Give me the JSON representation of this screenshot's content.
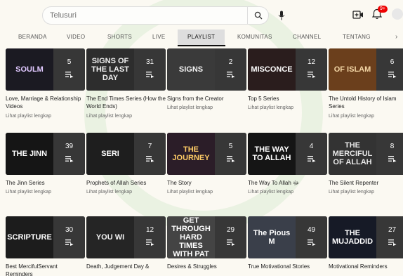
{
  "search": {
    "placeholder": "Telusuri"
  },
  "notifications": {
    "badge": "9+"
  },
  "tabs": [
    {
      "label": "BERANDA"
    },
    {
      "label": "VIDEO"
    },
    {
      "label": "SHORTS"
    },
    {
      "label": "LIVE"
    },
    {
      "label": "PLAYLIST",
      "active": true
    },
    {
      "label": "KOMUNITAS"
    },
    {
      "label": "CHANNEL"
    },
    {
      "label": "TENTANG"
    }
  ],
  "view_full_label": "Lihat playlist lengkap",
  "playlists": [
    {
      "title": "Love, Marriage & Relationship Videos",
      "count": "5",
      "thumb_text": "SOULM",
      "thumb_color": "#e0c8ff",
      "bg": "#1b1a22",
      "show_link": true
    },
    {
      "title": "The End Times Series (How the World Ends)",
      "count": "31",
      "thumb_text": "SIGNS OF THE LAST DAY",
      "thumb_color": "#f1f1f1",
      "bg": "#2d2d2d",
      "show_link": true
    },
    {
      "title": "Signs from the Creator",
      "count": "2",
      "thumb_text": "SIGNS",
      "thumb_color": "#f3f3f3",
      "bg": "#3a3a3a",
      "show_link": true
    },
    {
      "title": "Top 5 Series",
      "count": "12",
      "thumb_text": "MISCONCE",
      "thumb_color": "#ffffff",
      "bg": "#2a1d1d",
      "show_link": true
    },
    {
      "title": "The Untold History of Islam Series",
      "count": "6",
      "thumb_text": "OF ISLAM",
      "thumb_color": "#f4d7a6",
      "bg": "#6b3f1c",
      "show_link": true
    },
    {
      "title": "The Jinn Series",
      "count": "39",
      "thumb_text": "THE JINN",
      "thumb_color": "#ffffff",
      "bg": "#151515",
      "show_link": true
    },
    {
      "title": "Prophets of Allah Series",
      "count": "7",
      "thumb_text": "SERI",
      "thumb_color": "#ffffff",
      "bg": "#1e1e1e",
      "show_link": true
    },
    {
      "title": "The Story",
      "count": "5",
      "thumb_text": "THE JOURNEY",
      "thumb_color": "#ffcc66",
      "bg": "#2b1d28",
      "show_link": true
    },
    {
      "title": "The Way To Allah ﷻ",
      "count": "4",
      "thumb_text": "THE WAY TO ALLAH",
      "thumb_color": "#ffffff",
      "bg": "#151515",
      "show_link": true
    },
    {
      "title": "The Silent Repenter",
      "count": "8",
      "thumb_text": "THE MERCIFUL OF ALLAH",
      "thumb_color": "#e9e9e9",
      "bg": "#333333",
      "show_link": true
    },
    {
      "title": "Best MercifulServant Reminders",
      "count": "30",
      "thumb_text": "SCRIPTURE",
      "thumb_color": "#ffffff",
      "bg": "#1c1c1c",
      "show_link": false
    },
    {
      "title": "Death, Judgement Day &",
      "count": "12",
      "thumb_text": "YOU WI",
      "thumb_color": "#f2f2f2",
      "bg": "#252525",
      "show_link": false
    },
    {
      "title": "Desires & Struggles",
      "count": "29",
      "thumb_text": "GET THROUGH HARD TIMES WITH PAT",
      "thumb_color": "#ffffff",
      "bg": "#444444",
      "show_link": false
    },
    {
      "title": "True Motivational Stories",
      "count": "49",
      "thumb_text": "The Pious M",
      "thumb_color": "#ffffff",
      "bg": "#3a3f4a",
      "show_link": false
    },
    {
      "title": "Motivational Reminders",
      "count": "27",
      "thumb_text": "THE MUJADDID",
      "thumb_color": "#ffffff",
      "bg": "#161a26",
      "show_link": false
    }
  ]
}
